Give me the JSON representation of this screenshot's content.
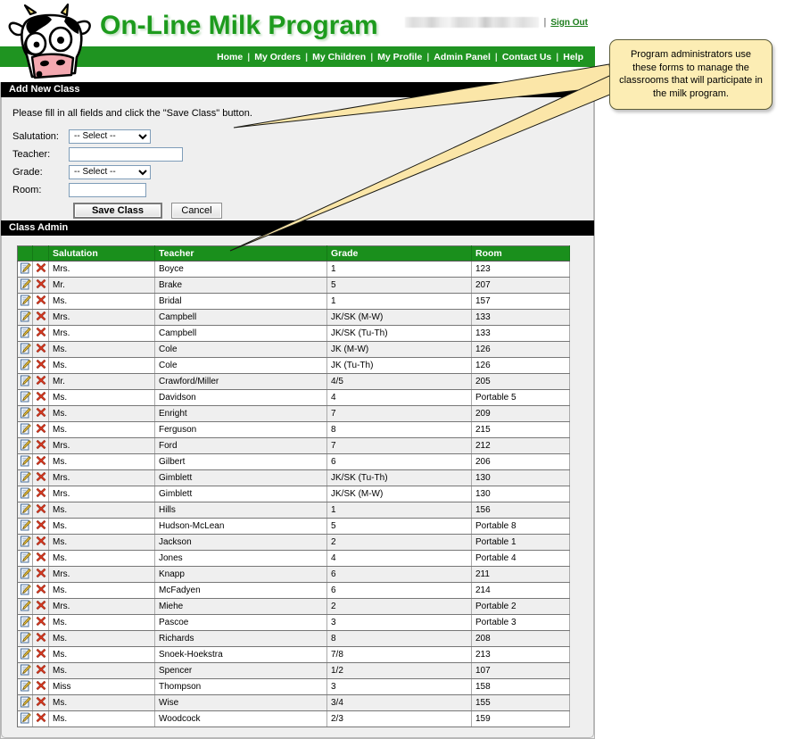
{
  "site": {
    "title": "On-Line Milk Program",
    "logo_icon": "cow-head-icon",
    "username_redacted": "",
    "bar_separator": "|",
    "sign_out": "Sign Out"
  },
  "nav": {
    "separator": "|",
    "items": [
      {
        "label": "Home"
      },
      {
        "label": "My Orders"
      },
      {
        "label": "My Children"
      },
      {
        "label": "My Profile"
      },
      {
        "label": "Admin Panel"
      },
      {
        "label": "Contact Us"
      },
      {
        "label": "Help"
      }
    ]
  },
  "add_class": {
    "section_title": "Add New Class",
    "instructions": "Please fill in all fields and click the \"Save Class\" button.",
    "fields": {
      "salutation_label": "Salutation:",
      "salutation_value": "-- Select --",
      "teacher_label": "Teacher:",
      "teacher_value": "",
      "teacher_placeholder": "",
      "grade_label": "Grade:",
      "grade_value": "-- Select --",
      "room_label": "Room:",
      "room_value": "",
      "room_placeholder": ""
    },
    "save_button": "Save Class",
    "cancel_button": "Cancel"
  },
  "class_admin": {
    "section_title": "Class Admin",
    "columns": [
      "",
      "",
      "Salutation",
      "Teacher",
      "Grade",
      "Room"
    ],
    "edit_icon": "edit-pencil-icon",
    "delete_icon": "delete-x-icon",
    "rows": [
      {
        "salutation": "Mrs.",
        "teacher": "Boyce",
        "grade": "1",
        "room": "123"
      },
      {
        "salutation": "Mr.",
        "teacher": "Brake",
        "grade": "5",
        "room": "207"
      },
      {
        "salutation": "Ms.",
        "teacher": "Bridal",
        "grade": "1",
        "room": "157"
      },
      {
        "salutation": "Mrs.",
        "teacher": "Campbell",
        "grade": "JK/SK (M-W)",
        "room": "133"
      },
      {
        "salutation": "Mrs.",
        "teacher": "Campbell",
        "grade": "JK/SK (Tu-Th)",
        "room": "133"
      },
      {
        "salutation": "Ms.",
        "teacher": "Cole",
        "grade": "JK (M-W)",
        "room": "126"
      },
      {
        "salutation": "Ms.",
        "teacher": "Cole",
        "grade": "JK (Tu-Th)",
        "room": "126"
      },
      {
        "salutation": "Mr.",
        "teacher": "Crawford/Miller",
        "grade": "4/5",
        "room": "205"
      },
      {
        "salutation": "Ms.",
        "teacher": "Davidson",
        "grade": "4",
        "room": "Portable 5"
      },
      {
        "salutation": "Ms.",
        "teacher": "Enright",
        "grade": "7",
        "room": "209"
      },
      {
        "salutation": "Ms.",
        "teacher": "Ferguson",
        "grade": "8",
        "room": "215"
      },
      {
        "salutation": "Mrs.",
        "teacher": "Ford",
        "grade": "7",
        "room": "212"
      },
      {
        "salutation": "Ms.",
        "teacher": "Gilbert",
        "grade": "6",
        "room": "206"
      },
      {
        "salutation": "Mrs.",
        "teacher": "Gimblett",
        "grade": "JK/SK (Tu-Th)",
        "room": "130"
      },
      {
        "salutation": "Mrs.",
        "teacher": "Gimblett",
        "grade": "JK/SK (M-W)",
        "room": "130"
      },
      {
        "salutation": "Ms.",
        "teacher": "Hills",
        "grade": "1",
        "room": "156"
      },
      {
        "salutation": "Ms.",
        "teacher": "Hudson-McLean",
        "grade": "5",
        "room": "Portable 8"
      },
      {
        "salutation": "Ms.",
        "teacher": "Jackson",
        "grade": "2",
        "room": "Portable 1"
      },
      {
        "salutation": "Ms.",
        "teacher": "Jones",
        "grade": "4",
        "room": "Portable 4"
      },
      {
        "salutation": "Mrs.",
        "teacher": "Knapp",
        "grade": "6",
        "room": "211"
      },
      {
        "salutation": "Ms.",
        "teacher": "McFadyen",
        "grade": "6",
        "room": "214"
      },
      {
        "salutation": "Mrs.",
        "teacher": "Miehe",
        "grade": "2",
        "room": "Portable 2"
      },
      {
        "salutation": "Ms.",
        "teacher": "Pascoe",
        "grade": "3",
        "room": "Portable 3"
      },
      {
        "salutation": "Ms.",
        "teacher": "Richards",
        "grade": "8",
        "room": "208"
      },
      {
        "salutation": "Ms.",
        "teacher": "Snoek-Hoekstra",
        "grade": "7/8",
        "room": "213"
      },
      {
        "salutation": "Ms.",
        "teacher": "Spencer",
        "grade": "1/2",
        "room": "107"
      },
      {
        "salutation": "Miss",
        "teacher": "Thompson",
        "grade": "3",
        "room": "158"
      },
      {
        "salutation": "Ms.",
        "teacher": "Wise",
        "grade": "3/4",
        "room": "155"
      },
      {
        "salutation": "Ms.",
        "teacher": "Woodcock",
        "grade": "2/3",
        "room": "159"
      }
    ]
  },
  "callout": {
    "text": "Program administrators use these forms to manage the classrooms that will participate in the milk program."
  },
  "colors": {
    "brand_green": "#1d9b1d",
    "nav_green": "#1f9421",
    "header_green": "#1a8f1c",
    "section_black": "#000000",
    "callout_yellow": "#fcedb4",
    "delete_red": "#d93a22"
  }
}
